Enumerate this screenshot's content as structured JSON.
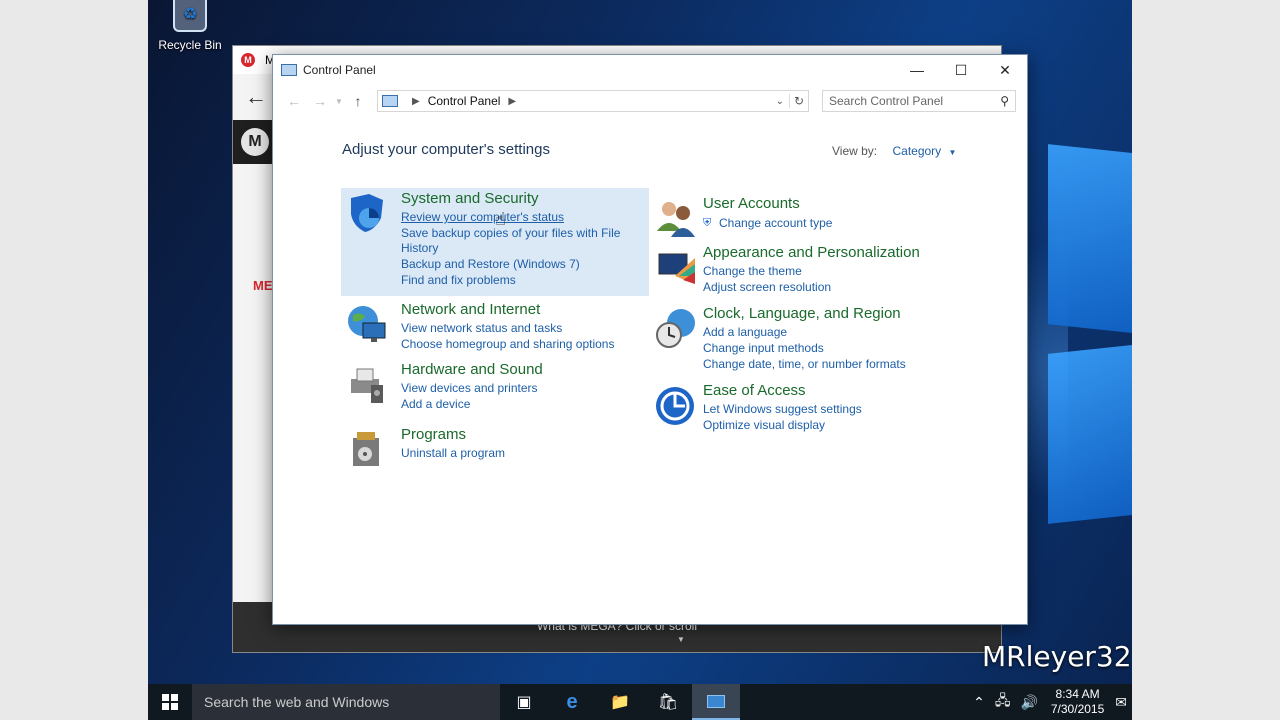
{
  "desktop": {
    "recycle_bin": "Recycle Bin"
  },
  "mega": {
    "title_initial": "M",
    "logo_letter": "M",
    "red_text": "ME",
    "bottom_text": "What is MEGA? Click or scroll"
  },
  "control_panel": {
    "window_title": "Control Panel",
    "breadcrumb": "Control Panel",
    "search_placeholder": "Search Control Panel",
    "heading": "Adjust your computer's settings",
    "view_by_label": "View by:",
    "view_by_value": "Category",
    "left_column": [
      {
        "title": "System and Security",
        "links": [
          "Review your computer's status",
          "Save backup copies of your files with File",
          "History",
          "Backup and Restore (Windows 7)",
          "Find and fix problems"
        ]
      },
      {
        "title": "Network and Internet",
        "links": [
          "View network status and tasks",
          "Choose homegroup and sharing options"
        ]
      },
      {
        "title": "Hardware and Sound",
        "links": [
          "View devices and printers",
          "Add a device"
        ]
      },
      {
        "title": "Programs",
        "links": [
          "Uninstall a program"
        ]
      }
    ],
    "right_column": [
      {
        "title": "User Accounts",
        "links": [
          "Change account type"
        ]
      },
      {
        "title": "Appearance and Personalization",
        "links": [
          "Change the theme",
          "Adjust screen resolution"
        ]
      },
      {
        "title": "Clock, Language, and Region",
        "links": [
          "Add a language",
          "Change input methods",
          "Change date, time, or number formats"
        ]
      },
      {
        "title": "Ease of Access",
        "links": [
          "Let Windows suggest settings",
          "Optimize visual display"
        ]
      }
    ]
  },
  "taskbar": {
    "search_text": "Search the web and Windows",
    "time": "8:34 AM",
    "date": "7/30/2015"
  },
  "watermark": "MRleyer32",
  "colors": {
    "link": "#1e5fa8",
    "category_title": "#1a6a2c",
    "highlight": "#dbe8f6",
    "taskbar": "#101820"
  }
}
